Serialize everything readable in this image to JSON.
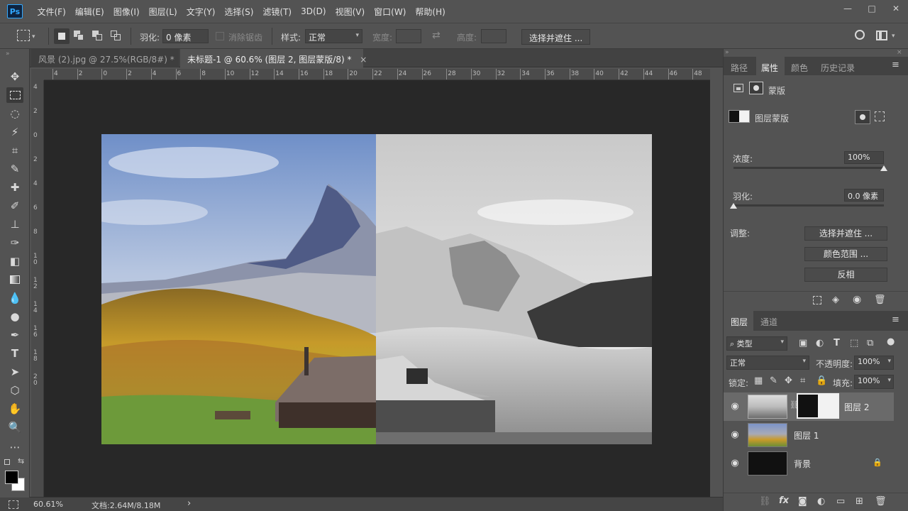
{
  "app": {
    "logo": "Ps"
  },
  "menu": [
    "文件(F)",
    "编辑(E)",
    "图像(I)",
    "图层(L)",
    "文字(Y)",
    "选择(S)",
    "滤镜(T)",
    "3D(D)",
    "视图(V)",
    "窗口(W)",
    "帮助(H)"
  ],
  "window_controls": {
    "minimize": "—",
    "maximize": "□",
    "close": "✕"
  },
  "options": {
    "feather_label": "羽化:",
    "feather_value": "0 像素",
    "antialias_label": "消除锯齿",
    "style_label": "样式:",
    "style_value": "正常",
    "width_label": "宽度:",
    "height_label": "高度:",
    "select_mask_button": "选择并遮住 ..."
  },
  "tabs": [
    {
      "label": "风景 (2).jpg @ 27.5%(RGB/8#) *",
      "close": "×"
    },
    {
      "label": "未标题-1 @ 60.6% (图层 2, 图层蒙版/8) *",
      "close": "×"
    }
  ],
  "ruler_top": [
    "4",
    "2",
    "0",
    "2",
    "4",
    "6",
    "8",
    "10",
    "12",
    "14",
    "16",
    "18",
    "20",
    "22",
    "24",
    "26",
    "28",
    "30",
    "32",
    "34",
    "36",
    "38",
    "40",
    "42",
    "44",
    "46",
    "48"
  ],
  "ruler_left": [
    "4",
    "2",
    "0",
    "2",
    "4",
    "6",
    "8",
    "1 0",
    "1 2",
    "1 4",
    "1 6",
    "1 8",
    "2 0"
  ],
  "status": {
    "zoom": "60.61%",
    "doc": "文档:2.64M/8.18M",
    "arrow": "›"
  },
  "properties_panel": {
    "tabs": [
      "路径",
      "属性",
      "颜色",
      "历史记录"
    ],
    "mask_title": "蒙版",
    "layer_mask_label": "图层蒙版",
    "density_label": "浓度:",
    "density_value": "100%",
    "density": 1.0,
    "feather_label": "羽化:",
    "feather_value": "0.0 像素",
    "feather": 0.0,
    "adjust_label": "调整:",
    "buttons": [
      "选择并遮住 ...",
      "颜色范围 ...",
      "反相"
    ]
  },
  "layers_panel": {
    "tabs": [
      "图层",
      "通道"
    ],
    "filter_label": "类型",
    "blend_mode": "正常",
    "opacity_label": "不透明度:",
    "opacity_value": "100%",
    "lock_label": "锁定:",
    "fill_label": "填充:",
    "fill_value": "100%",
    "layers": [
      {
        "name": "图层 2",
        "selected": true,
        "has_mask": true
      },
      {
        "name": "图层 1",
        "selected": false
      },
      {
        "name": "背景",
        "selected": false,
        "locked": true
      }
    ],
    "footer_icons": [
      "link-icon",
      "fx-icon",
      "add-mask-icon",
      "adjustment-icon",
      "group-icon",
      "new-layer-icon",
      "trash-icon"
    ],
    "fx_text": "fx"
  },
  "colors": {
    "accent": "#31a8ff",
    "chrome": "#535353",
    "canvas_bg": "#282828"
  }
}
